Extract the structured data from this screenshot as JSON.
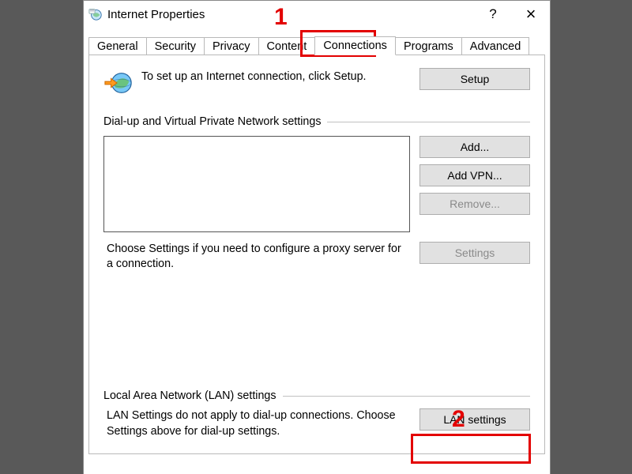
{
  "titlebar": {
    "title": "Internet Properties",
    "help": "?",
    "close": "×"
  },
  "tabs": {
    "general": "General",
    "security": "Security",
    "privacy": "Privacy",
    "content": "Content",
    "connections": "Connections",
    "programs": "Programs",
    "advanced": "Advanced"
  },
  "panel": {
    "intro": "To set up an Internet connection, click Setup.",
    "setup_btn": "Setup",
    "dialup_group": "Dial-up and Virtual Private Network settings",
    "add_btn": "Add...",
    "addvpn_btn": "Add VPN...",
    "remove_btn": "Remove...",
    "settings_btn": "Settings",
    "proxy_note": "Choose Settings if you need to configure a proxy server for a connection.",
    "lan_group": "Local Area Network (LAN) settings",
    "lan_note": "LAN Settings do not apply to dial-up connections. Choose Settings above for dial-up settings.",
    "lan_btn": "LAN settings"
  },
  "annotations": {
    "one": "1",
    "two": "2"
  }
}
